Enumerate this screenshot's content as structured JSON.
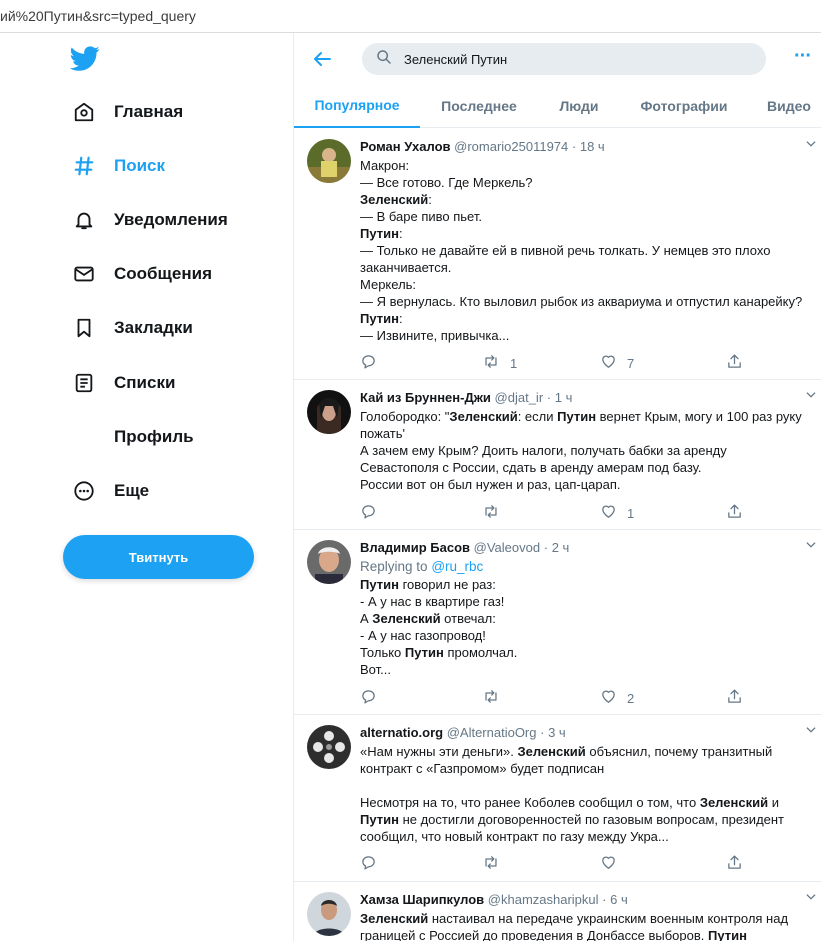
{
  "browser": {
    "url": "ий%20Путин&src=typed_query"
  },
  "sidebar": {
    "items": [
      {
        "label": "Главная"
      },
      {
        "label": "Поиск"
      },
      {
        "label": "Уведомления"
      },
      {
        "label": "Сообщения"
      },
      {
        "label": "Закладки"
      },
      {
        "label": "Списки"
      },
      {
        "label": "Профиль"
      },
      {
        "label": "Еще"
      }
    ],
    "tweet_button": "Твитнуть"
  },
  "search": {
    "value": "Зеленский Путин"
  },
  "tabs": [
    {
      "label": "Популярное"
    },
    {
      "label": "Последнее"
    },
    {
      "label": "Люди"
    },
    {
      "label": "Фотографии"
    },
    {
      "label": "Видео"
    }
  ],
  "colors": {
    "accent": "#1da1f2",
    "text": "#14171a",
    "muted": "#657786",
    "border": "#e6ecf0"
  },
  "tweets": [
    {
      "name": "Роман Ухалов",
      "handle": "@romario25011974",
      "time": "18 ч",
      "lines": [
        [
          {
            "t": "Макрон:"
          }
        ],
        [
          {
            "t": "— Все готово. Где Меркель?"
          }
        ],
        [
          {
            "t": "Зеленский",
            "b": true
          },
          {
            "t": ":"
          }
        ],
        [
          {
            "t": "— В баре пиво пьет."
          }
        ],
        [
          {
            "t": "Путин",
            "b": true
          },
          {
            "t": ":"
          }
        ],
        [
          {
            "t": "— Только не давайте ей в пивной речь толкать. У немцев это плохо"
          }
        ],
        [
          {
            "t": "заканчивается."
          }
        ],
        [
          {
            "t": "Меркель:"
          }
        ],
        [
          {
            "t": "— Я вернулась. Кто выловил рыбок из аквариума и отпустил канарейку?"
          }
        ],
        [
          {
            "t": "Путин",
            "b": true
          },
          {
            "t": ":"
          }
        ],
        [
          {
            "t": "— Извините, привычка..."
          }
        ]
      ],
      "retweets": "1",
      "likes": "7"
    },
    {
      "name": "Кай из Бруннен-Джи",
      "handle": "@djat_ir",
      "time": "1 ч",
      "lines": [
        [
          {
            "t": "Голобородко: \""
          },
          {
            "t": "Зеленский",
            "b": true
          },
          {
            "t": ": если "
          },
          {
            "t": "Путин",
            "b": true
          },
          {
            "t": " вернет Крым, могу и 100 раз руку"
          }
        ],
        [
          {
            "t": "пожать'"
          }
        ],
        [
          {
            "t": "А зачем ему Крым? Доить налоги, получать бабки за аренду"
          }
        ],
        [
          {
            "t": "Севастополя с России, сдать в аренду амерам под базу."
          }
        ],
        [
          {
            "t": "России вот он был нужен и раз, цап-царап."
          }
        ]
      ],
      "retweets": "",
      "likes": "1"
    },
    {
      "name": "Владимир Басов",
      "handle": "@Valeovod",
      "time": "2 ч",
      "replying_label": "Replying to",
      "replying_to": "@ru_rbc",
      "lines": [
        [
          {
            "t": "Путин",
            "b": true
          },
          {
            "t": " говорил не раз:"
          }
        ],
        [
          {
            "t": "- А у нас в квартире газ!"
          }
        ],
        [
          {
            "t": "А "
          },
          {
            "t": "Зеленский",
            "b": true
          },
          {
            "t": " отвечал:"
          }
        ],
        [
          {
            "t": "- А у нас газопровод!"
          }
        ],
        [
          {
            "t": "Только "
          },
          {
            "t": "Путин",
            "b": true
          },
          {
            "t": " промолчал."
          }
        ],
        [
          {
            "t": "Вот..."
          }
        ]
      ],
      "retweets": "",
      "likes": "2"
    },
    {
      "name": "alternatio.org",
      "handle": "@AlternatioOrg",
      "time": "3 ч",
      "lines": [
        [
          {
            "t": "«Нам нужны эти деньги». "
          },
          {
            "t": "Зеленский",
            "b": true
          },
          {
            "t": " объяснил, почему транзитный"
          }
        ],
        [
          {
            "t": "контракт с «Газпромом» будет подписан"
          }
        ],
        [
          {
            "t": " "
          }
        ],
        [
          {
            "t": "Несмотря на то, что ранее Коболев сообщил о том, что "
          },
          {
            "t": "Зеленский",
            "b": true
          },
          {
            "t": " и"
          }
        ],
        [
          {
            "t": "Путин",
            "b": true
          },
          {
            "t": " не достигли договоренностей по газовым вопросам, президент"
          }
        ],
        [
          {
            "t": "сообщил, что новый контракт по газу между Укра..."
          }
        ]
      ],
      "retweets": "",
      "likes": ""
    },
    {
      "name": "Хамза Шарипкулов",
      "handle": "@khamzasharipkul",
      "time": "6 ч",
      "lines": [
        [
          {
            "t": "Зеленский",
            "b": true
          },
          {
            "t": " настаивал на передаче украинским военным контроля над"
          }
        ],
        [
          {
            "t": "границей с Россией до проведения в Донбассе выборов. "
          },
          {
            "t": "Путин",
            "b": true
          }
        ]
      ],
      "retweets": "",
      "likes": ""
    }
  ]
}
